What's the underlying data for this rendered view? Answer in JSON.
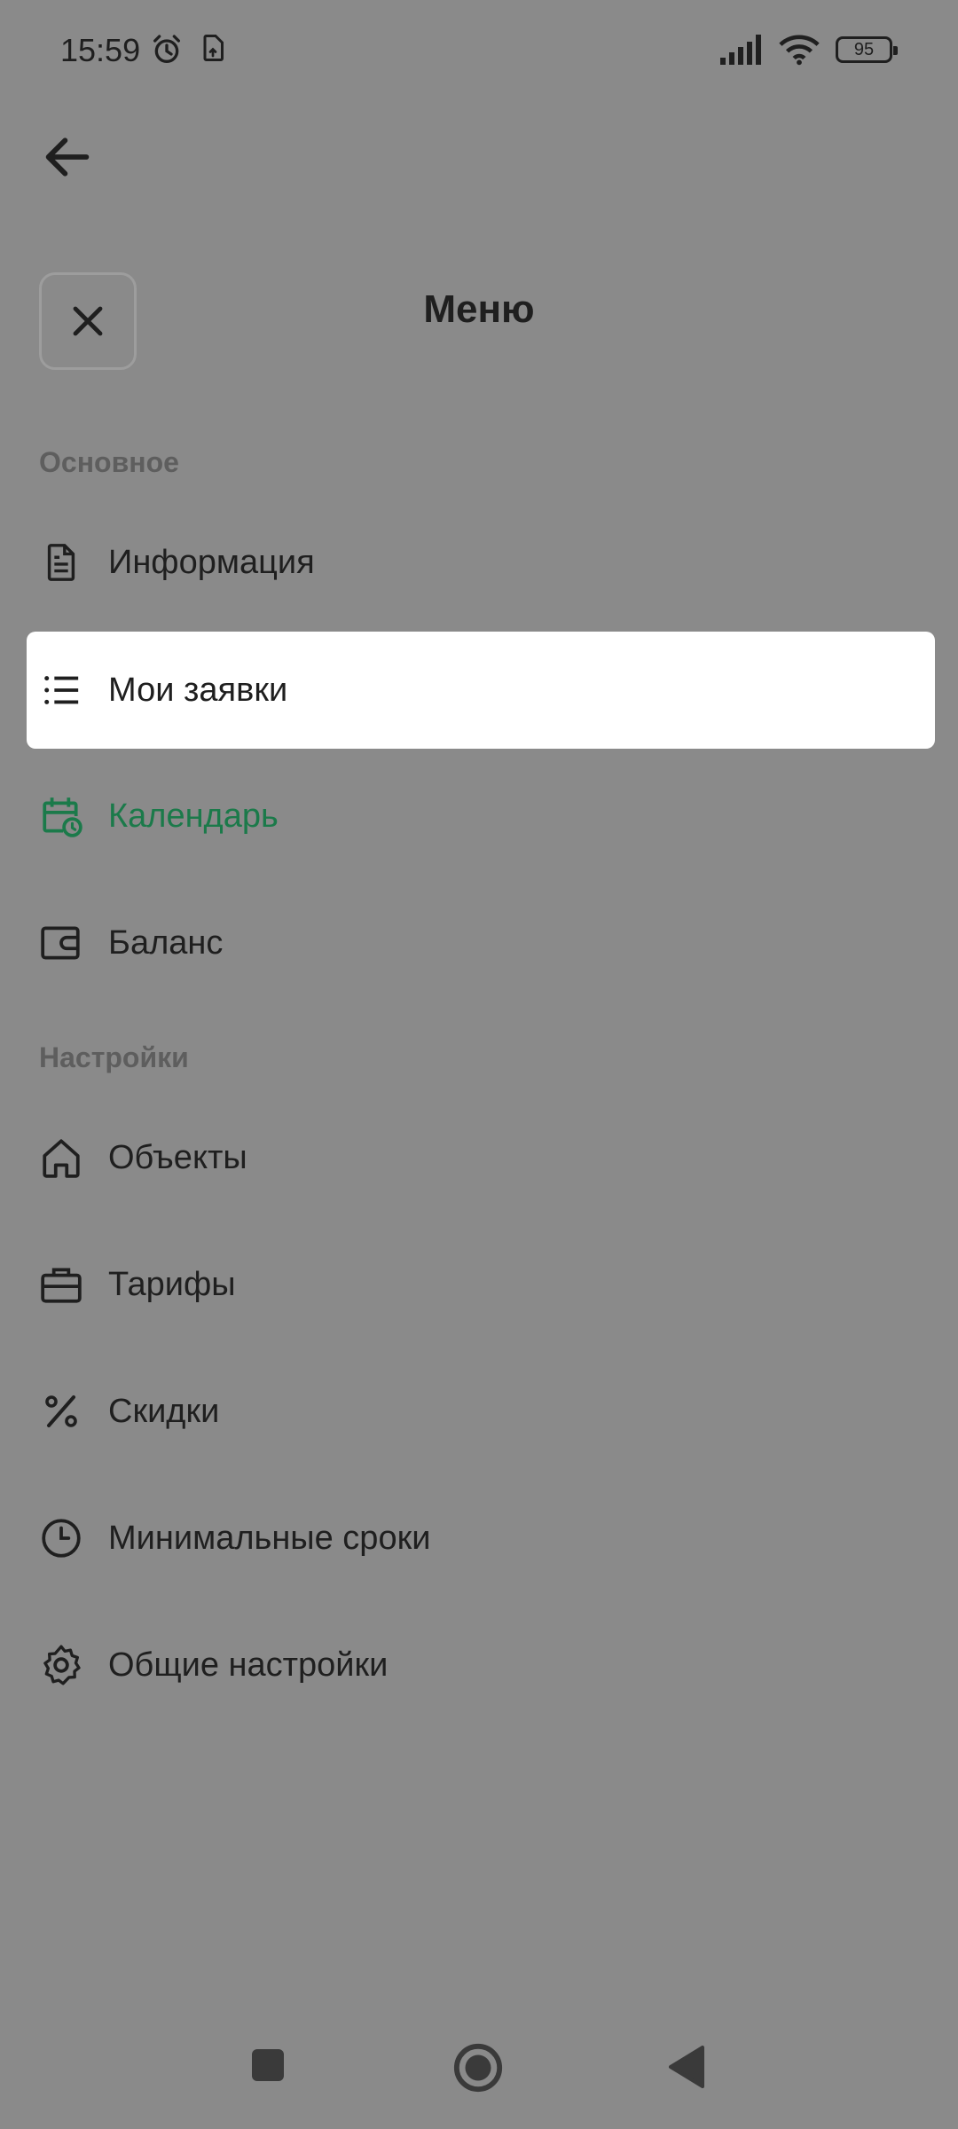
{
  "status": {
    "time": "15:59",
    "battery": "95"
  },
  "header": {
    "title": "Меню"
  },
  "sections": {
    "main": "Основное",
    "settings": "Настройки"
  },
  "items": [
    {
      "label": "Информация",
      "icon": "document-icon"
    },
    {
      "label": "Мои заявки",
      "icon": "list-icon"
    },
    {
      "label": "Календарь",
      "icon": "calendar-clock-icon"
    },
    {
      "label": "Баланс",
      "icon": "wallet-icon"
    },
    {
      "label": "Объекты",
      "icon": "home-icon"
    },
    {
      "label": "Тарифы",
      "icon": "briefcase-icon"
    },
    {
      "label": "Скидки",
      "icon": "percent-icon"
    },
    {
      "label": "Минимальные сроки",
      "icon": "clock-icon"
    },
    {
      "label": "Общие настройки",
      "icon": "gear-icon"
    }
  ],
  "colors": {
    "accent": "#1b7a4a",
    "overlay": "#8a8a8a",
    "active_bg": "#ffffff"
  }
}
